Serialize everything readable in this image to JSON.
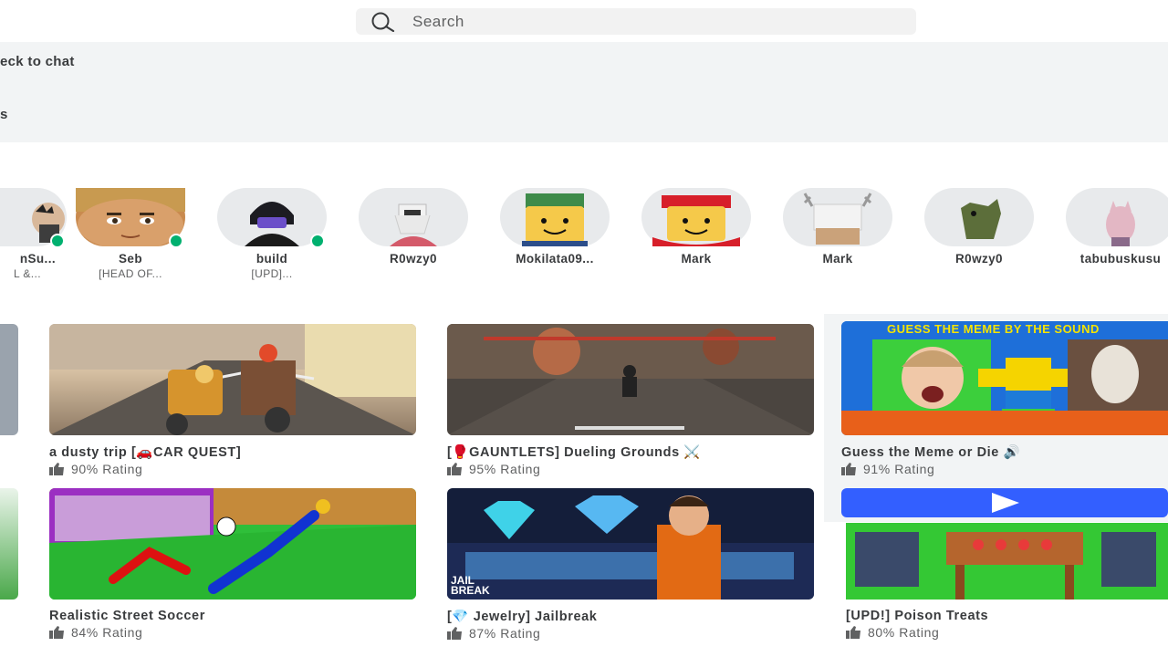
{
  "search": {
    "placeholder": "Search"
  },
  "panel": {
    "row1": "eck to chat",
    "row2": "s"
  },
  "friends": [
    {
      "name": "nSu...",
      "status": "L &...",
      "online": true
    },
    {
      "name": "Seb",
      "status": "[HEAD OF...",
      "online": true
    },
    {
      "name": "build",
      "status": "[UPD]...",
      "online": true
    },
    {
      "name": "R0wzy0",
      "status": "",
      "online": false
    },
    {
      "name": "Mokilata09...",
      "status": "",
      "online": false
    },
    {
      "name": "Mark",
      "status": "",
      "online": false
    },
    {
      "name": "Mark",
      "status": "",
      "online": false
    },
    {
      "name": "R0wzy0",
      "status": "",
      "online": false
    },
    {
      "name": "tabubuskusu",
      "status": "",
      "online": false
    }
  ],
  "games": [
    {
      "title": "a dusty trip [🚗CAR QUEST]",
      "rating": "90% Rating"
    },
    {
      "title": "[🥊GAUNTLETS] Dueling Grounds ⚔️",
      "rating": "95% Rating"
    },
    {
      "title": "Guess the Meme or Die 🔊",
      "rating": "91% Rating",
      "banner": "GUESS THE MEME BY THE SOUND"
    },
    {
      "title": "Realistic Street Soccer",
      "rating": "84% Rating"
    },
    {
      "title": "[💎 Jewelry] Jailbreak",
      "rating": "87% Rating",
      "logo": "JAIL BREAK"
    },
    {
      "title": "[UPD!] Poison Treats",
      "rating": "80% Rating"
    }
  ],
  "colors": {
    "accent": "#335fff",
    "online": "#00b06f",
    "panel": "#f2f4f5"
  }
}
